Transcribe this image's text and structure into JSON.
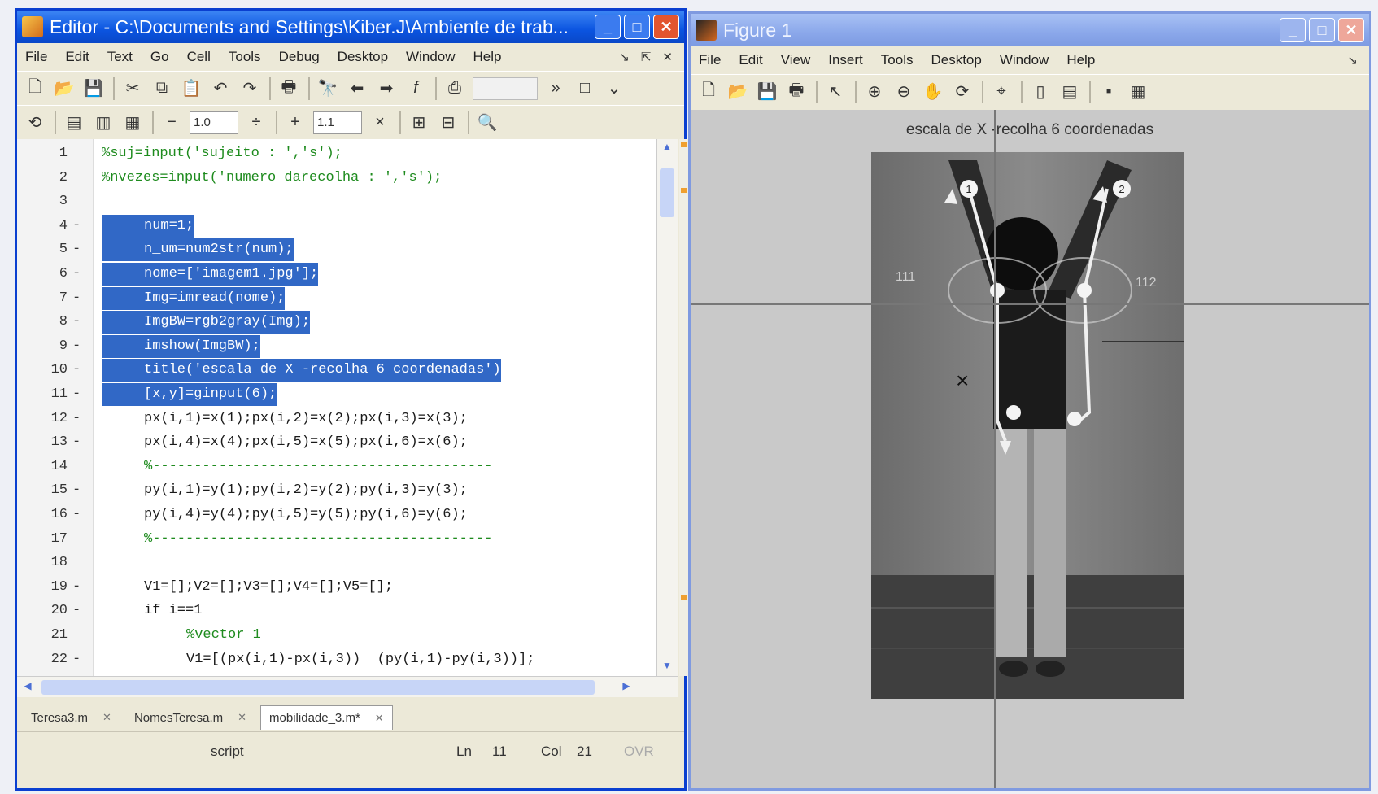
{
  "editor": {
    "title": "Editor - C:\\Documents and Settings\\Kiber.J\\Ambiente de trab...",
    "menu": [
      "File",
      "Edit",
      "Text",
      "Go",
      "Cell",
      "Tools",
      "Debug",
      "Desktop",
      "Window",
      "Help"
    ],
    "cell_minus_value": "1.0",
    "cell_plus_value": "1.1",
    "lines": [
      {
        "n": "1",
        "dash": "",
        "text": "%suj=input('sujeito : ','s');",
        "style": "comment",
        "indent": 0
      },
      {
        "n": "2",
        "dash": "",
        "text": "%nvezes=input('numero darecolha : ','s');",
        "style": "comment",
        "indent": 0
      },
      {
        "n": "3",
        "dash": "",
        "text": "",
        "style": "normal",
        "indent": 0
      },
      {
        "n": "4",
        "dash": "-",
        "text": "num=1;",
        "style": "sel",
        "indent": 1
      },
      {
        "n": "5",
        "dash": "-",
        "text": "n_um=num2str(num);",
        "style": "sel",
        "indent": 1
      },
      {
        "n": "6",
        "dash": "-",
        "text": "nome=['imagem1.jpg'];",
        "style": "sel",
        "indent": 1
      },
      {
        "n": "7",
        "dash": "-",
        "text": "Img=imread(nome);",
        "style": "sel",
        "indent": 1
      },
      {
        "n": "8",
        "dash": "-",
        "text": "ImgBW=rgb2gray(Img);",
        "style": "sel",
        "indent": 1
      },
      {
        "n": "9",
        "dash": "-",
        "text": "imshow(ImgBW);",
        "style": "sel",
        "indent": 1
      },
      {
        "n": "10",
        "dash": "-",
        "text": "title('escala de X -recolha 6 coordenadas')",
        "style": "sel",
        "indent": 1
      },
      {
        "n": "11",
        "dash": "-",
        "text": "[x,y]=ginput(6);",
        "style": "sel",
        "indent": 1
      },
      {
        "n": "12",
        "dash": "-",
        "text": "px(i,1)=x(1);px(i,2)=x(2);px(i,3)=x(3);",
        "style": "normal",
        "indent": 1
      },
      {
        "n": "13",
        "dash": "-",
        "text": "px(i,4)=x(4);px(i,5)=x(5);px(i,6)=x(6);",
        "style": "normal",
        "indent": 1
      },
      {
        "n": "14",
        "dash": "",
        "text": "%-----------------------------------------",
        "style": "comment",
        "indent": 1
      },
      {
        "n": "15",
        "dash": "-",
        "text": "py(i,1)=y(1);py(i,2)=y(2);py(i,3)=y(3);",
        "style": "normal",
        "indent": 1
      },
      {
        "n": "16",
        "dash": "-",
        "text": "py(i,4)=y(4);py(i,5)=y(5);py(i,6)=y(6);",
        "style": "normal",
        "indent": 1
      },
      {
        "n": "17",
        "dash": "",
        "text": "%-----------------------------------------",
        "style": "comment",
        "indent": 1
      },
      {
        "n": "18",
        "dash": "",
        "text": "",
        "style": "normal",
        "indent": 1
      },
      {
        "n": "19",
        "dash": "-",
        "text": "V1=[];V2=[];V3=[];V4=[];V5=[];",
        "style": "normal",
        "indent": 1
      },
      {
        "n": "20",
        "dash": "-",
        "text": "if i==1",
        "style": "normal",
        "indent": 1
      },
      {
        "n": "21",
        "dash": "",
        "text": "%vector 1",
        "style": "comment",
        "indent": 2
      },
      {
        "n": "22",
        "dash": "-",
        "text": "V1=[(px(i,1)-px(i,3))  (py(i,1)-py(i,3))];",
        "style": "normal",
        "indent": 2
      }
    ],
    "tabs": [
      {
        "label": "Teresa3.m",
        "active": false
      },
      {
        "label": "NomesTeresa.m",
        "active": false
      },
      {
        "label": "mobilidade_3.m*",
        "active": true
      }
    ],
    "status": {
      "mode": "script",
      "ln_label": "Ln",
      "ln_value": "11",
      "col_label": "Col",
      "col_value": "21",
      "ovr": "OVR"
    }
  },
  "figure": {
    "title": "Figure 1",
    "menu": [
      "File",
      "Edit",
      "View",
      "Insert",
      "Tools",
      "Desktop",
      "Window",
      "Help"
    ],
    "plot_title": "escala de X -recolha 6 coordenadas",
    "annotations": [
      "111",
      "112"
    ],
    "points": [
      "1",
      "2"
    ]
  },
  "colors": {
    "titlebar_active": "#0b54e0",
    "titlebar_inactive": "#8aa7ea",
    "selection": "#3168c6",
    "comment": "#1e8b1e",
    "close_button": "#e2552f"
  }
}
